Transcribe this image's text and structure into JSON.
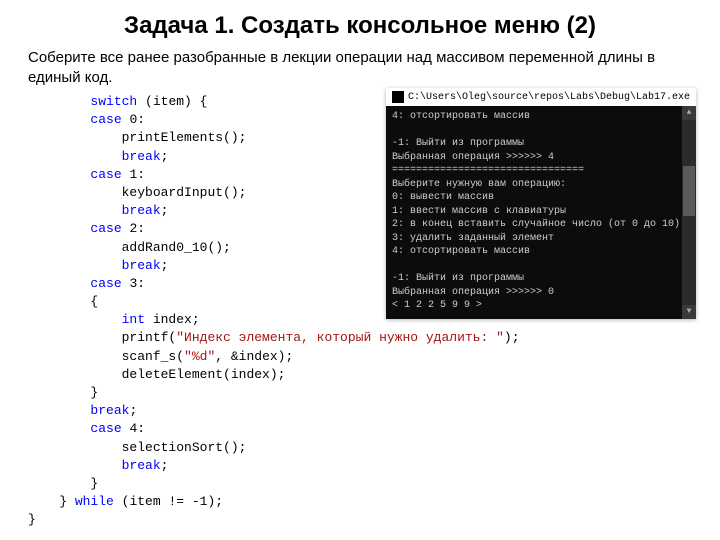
{
  "title": "Задача 1. Создать консольное меню (2)",
  "subtitle": "Соберите все ранее разобранные в лекции операции над массивом переменной длины в единый код.",
  "code": {
    "l1": {
      "kw": "switch",
      "rest": " (item) {"
    },
    "l2": {
      "kw": "case",
      "rest": " 0:"
    },
    "l3": "printElements();",
    "l4": {
      "kw": "break",
      "rest": ";"
    },
    "l5": {
      "kw": "case",
      "rest": " 1:"
    },
    "l6": "keyboardInput();",
    "l7": {
      "kw": "break",
      "rest": ";"
    },
    "l8": {
      "kw": "case",
      "rest": " 2:"
    },
    "l9": "addRand0_10();",
    "l10": {
      "kw": "break",
      "rest": ";"
    },
    "l11": {
      "kw": "case",
      "rest": " 3:"
    },
    "l12": "{",
    "l13": {
      "kw": "int",
      "rest": " index;"
    },
    "l14a": "printf(",
    "l14s": "\"Индекс элемента, который нужно удалить: \"",
    "l14b": ");",
    "l15a": "scanf_s(",
    "l15s": "\"%d\"",
    "l15b": ", &index);",
    "l16": "deleteElement(index);",
    "l17": "}",
    "l18": {
      "kw": "break",
      "rest": ";"
    },
    "l19": {
      "kw": "case",
      "rest": " 4:"
    },
    "l20": "selectionSort();",
    "l21": {
      "kw": "break",
      "rest": ";"
    },
    "l22": "}",
    "l23a": "} ",
    "l23kw": "while",
    "l23b": " (item != -1);",
    "l24": "}"
  },
  "console": {
    "titleIcon": "console-icon",
    "titlePath": "C:\\Users\\Oleg\\source\\repos\\Labs\\Debug\\Lab17.exe",
    "lines": [
      "4: отсортировать массив",
      "",
      "-1: Выйти из программы",
      "Выбранная операция >>>>>> 4",
      "================================",
      "Выберите нужную вам операцию:",
      "0: вывести массив",
      "1: ввести массив с клавиатуры",
      "2: в конец вставить случайное число (от 0 до 10)",
      "3: удалить заданный элемент",
      "4: отсортировать массив",
      "",
      "-1: Выйти из программы",
      "Выбранная операция >>>>>> 0",
      "< 1 2 2 5 9 9 >"
    ]
  }
}
